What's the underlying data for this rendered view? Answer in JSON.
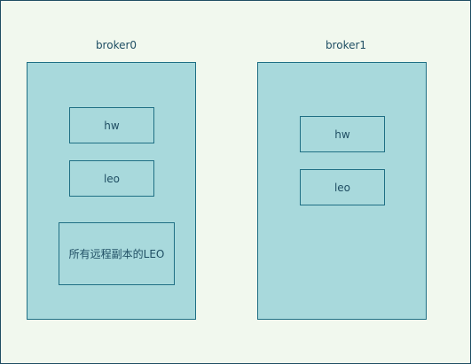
{
  "brokers": [
    {
      "label": "broker0",
      "items": [
        "hw",
        "leo",
        "所有远程副本的LEO"
      ]
    },
    {
      "label": "broker1",
      "items": [
        "hw",
        "leo"
      ]
    }
  ],
  "colors": {
    "background": "#f1f8ee",
    "container_fill": "#a8d9dc",
    "stroke": "#1f6f84",
    "text": "#1f4e63"
  }
}
